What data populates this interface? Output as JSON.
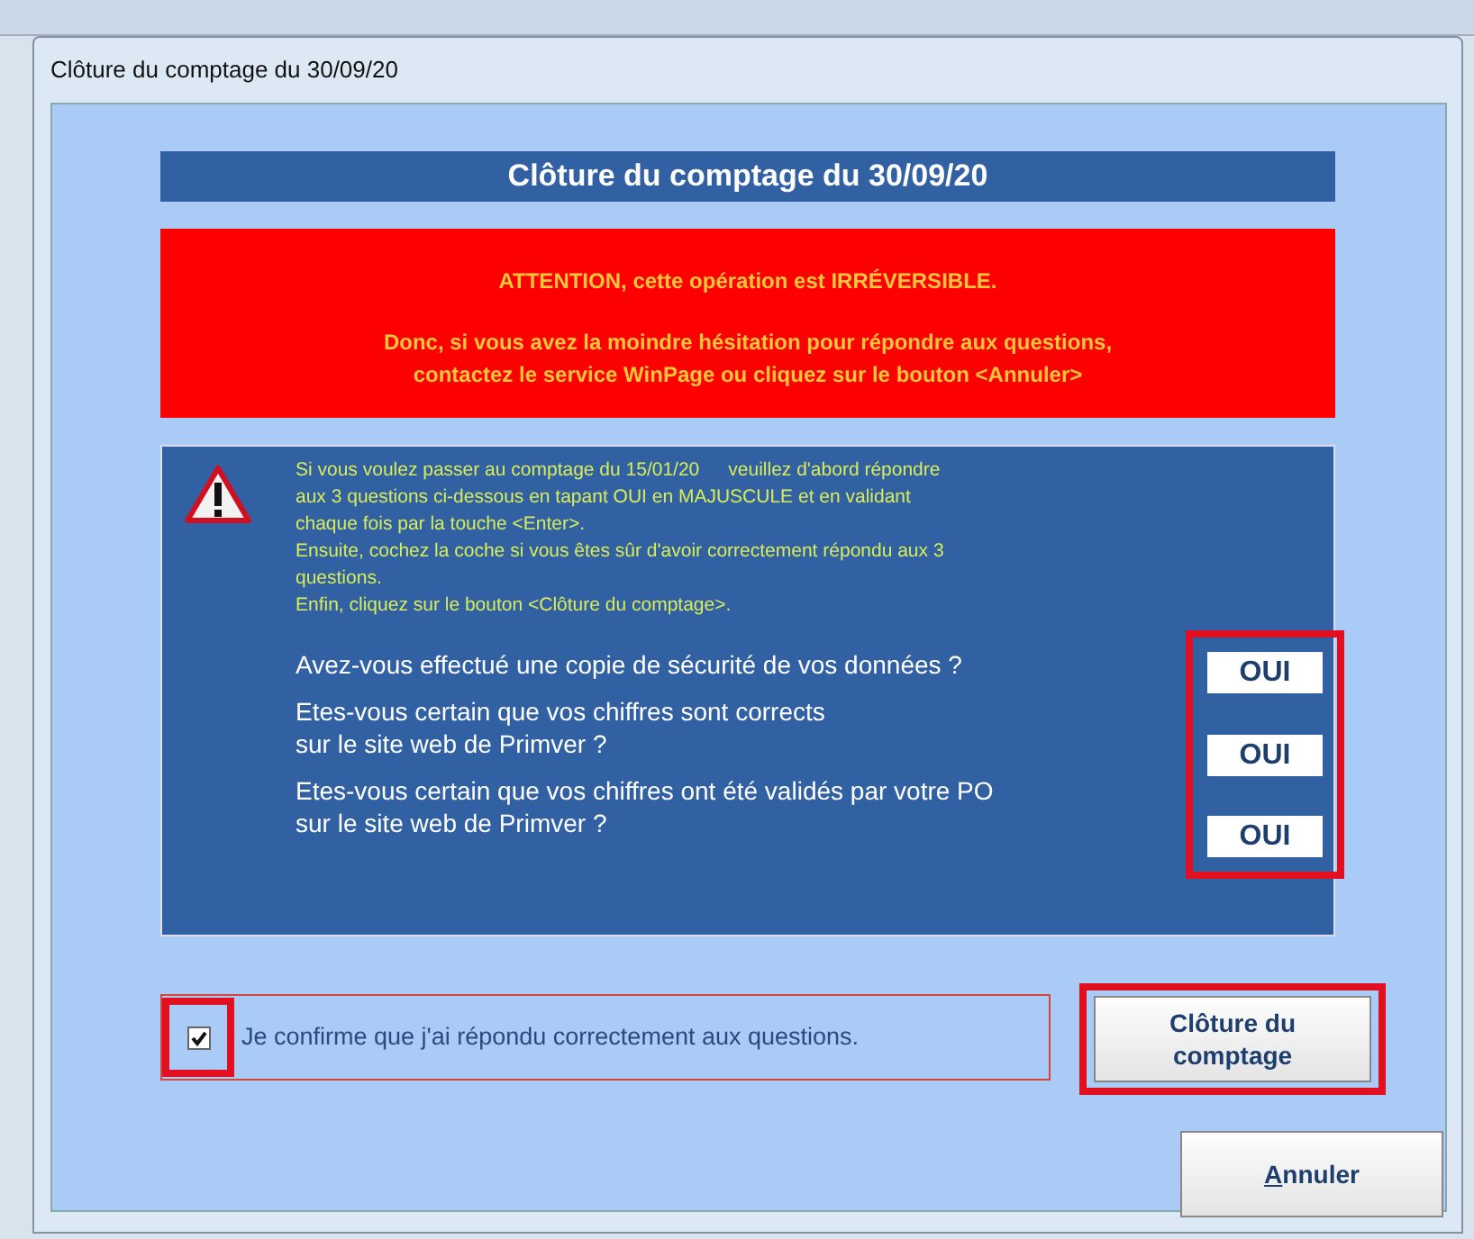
{
  "window": {
    "title": "Clôture du comptage du 30/09/20"
  },
  "header": "Clôture du comptage du 30/09/20",
  "warning": {
    "title": "ATTENTION, cette opération est IRRÉVERSIBLE.",
    "lines": [
      "Donc, si vous avez la moindre hésitation pour répondre aux questions,",
      "contactez le service WinPage ou cliquez sur le bouton <Annuler>"
    ]
  },
  "instructions": [
    "Si vous voulez passer au comptage du 15/01/20",
    "veuillez d'abord répondre",
    "aux 3 questions ci-dessous en tapant OUI en MAJUSCULE et en validant",
    "chaque fois par la touche <Enter>.",
    "Ensuite, cochez la coche si vous êtes sûr d'avoir correctement répondu aux 3",
    "questions.",
    "Enfin, cliquez sur le bouton <Clôture du comptage>."
  ],
  "questions": [
    {
      "lines": [
        "Avez-vous effectué une copie de sécurité de vos données ?"
      ],
      "answer": "OUI"
    },
    {
      "lines": [
        "Etes-vous certain que vos chiffres sont corrects",
        "sur le site web de Primver ?"
      ],
      "answer": "OUI"
    },
    {
      "lines": [
        "Etes-vous certain que vos chiffres ont été validés par votre PO",
        "sur le site web de Primver ?"
      ],
      "answer": "OUI"
    }
  ],
  "answers_highlighted": true,
  "confirm": {
    "label": "Je confirme que j'ai répondu correctement aux questions.",
    "checked": true,
    "highlighted": true
  },
  "close_button": {
    "lines": [
      "Clôture du",
      "comptage"
    ],
    "highlighted": true
  },
  "cancel_button": {
    "label": "Annuler"
  }
}
